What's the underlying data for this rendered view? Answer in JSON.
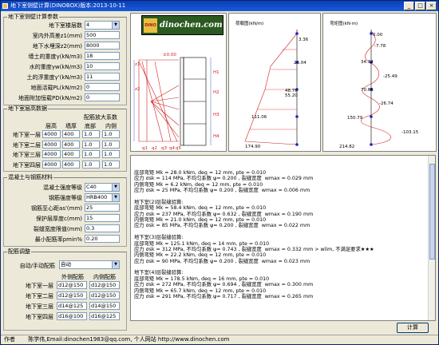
{
  "window": {
    "title": "地下室侧壁计算(DINOBOX)版本:2013-10-11",
    "btn_min": "_",
    "btn_max": "□",
    "btn_close": "×"
  },
  "basic": {
    "legend": "地下室侧壁计算参数",
    "rows": [
      {
        "label": "地下室楼层数",
        "value": "4",
        "type": "select"
      },
      {
        "label": "室内外高差z1(mm)",
        "value": "500"
      },
      {
        "label": "地下水埋深z2(mm)",
        "value": "8000"
      },
      {
        "label": "墙土的重度γ(kN/m3)",
        "value": "18"
      },
      {
        "label": "水的重度γw(kN/m3)",
        "value": "10"
      },
      {
        "label": "土的浮重度γ'(kN/m3)",
        "value": "11"
      },
      {
        "label": "地面活载PL(kN/m2)",
        "value": "0"
      },
      {
        "label": "地面附加恒载PD(kN/m2)",
        "value": "0"
      }
    ]
  },
  "floors": {
    "legend": "地下室层高数据",
    "col_height": "层高",
    "col_wall": "墙厚",
    "col_amp": "配筋放大系数",
    "col_out": "底部",
    "col_in": "内侧",
    "rows": [
      {
        "label": "地下室一层",
        "height": "4000",
        "wall": "400",
        "out": "1.0",
        "in": "1.0"
      },
      {
        "label": "地下室二层",
        "height": "4000",
        "wall": "400",
        "out": "1.0",
        "in": "1.0"
      },
      {
        "label": "地下室三层",
        "height": "4000",
        "wall": "400",
        "out": "1.0",
        "in": "1.0"
      },
      {
        "label": "地下室四层",
        "height": "4000",
        "wall": "400",
        "out": "1.0",
        "in": "1.0"
      }
    ]
  },
  "material": {
    "legend": "混凝土与钢筋材料",
    "rows": [
      {
        "label": "混凝土强度等级",
        "value": "C40",
        "type": "select"
      },
      {
        "label": "钢筋强度等级",
        "value": "HRB400",
        "type": "select"
      },
      {
        "label": "钢筋至心距as'(mm)",
        "value": "25"
      },
      {
        "label": "保护层厚度c(mm)",
        "value": "15"
      },
      {
        "label": "裂缝宽度限值(mm)",
        "value": "0.3"
      },
      {
        "label": "最小配筋率pmin%",
        "value": "0.20"
      }
    ]
  },
  "rebar": {
    "legend": "配筋调整",
    "mode_label": "自动/手动配筋",
    "mode_value": "自动",
    "col_out": "外侧配筋",
    "col_in": "内侧配筋",
    "rows": [
      {
        "label": "地下室一层",
        "out": "d12@150",
        "in": "d12@150"
      },
      {
        "label": "地下室二层",
        "out": "d12@150",
        "in": "d12@150"
      },
      {
        "label": "地下室三层",
        "out": "d14@125",
        "in": "d14@150"
      },
      {
        "label": "地下室四层",
        "out": "d16@100",
        "in": "d16@125"
      }
    ]
  },
  "logo": {
    "badge": "DINO",
    "text": "dinochen.com"
  },
  "diagram": {
    "labels": [
      "±0.00",
      "z1",
      "z2",
      "H1",
      "H2",
      "H3",
      "H4",
      "q1",
      "q2",
      "q3",
      "q4",
      "q5"
    ]
  },
  "load_chart": {
    "title": "荷载图(kN/m)",
    "values": [
      "3.36",
      "26.04",
      "48.76",
      "55.20",
      "111.06",
      "174.90"
    ]
  },
  "moment_chart": {
    "title": "弯矩图(kN·m)",
    "values": [
      "0.00",
      "-7.78",
      "34.34",
      "-25.49",
      "70.68",
      "-26.74",
      "150.79",
      "-103.15",
      "214.82"
    ]
  },
  "output": {
    "lines": [
      "底部弯矩 Mk = 28.0 kNm, deq = 12 mm, pte = 0.010",
      "应力 σsk = 114 MPa, 不均匀系数 ψ= 0.200 , 裂缝宽度  wmax = 0.029 mm",
      "内侧弯矩 Mk = 6.2 kNm, deq = 12 mm, pte = 0.010",
      "应力 σsk = 25 MPa, 不均匀系数 ψ= 0.200 , 裂缝宽度  wmax = 0.006 mm",
      "",
      "地下室(2)层裂缝验算:",
      "底部弯矩 Mk = 58.4 kNm, deq = 12 mm, pte = 0.010",
      "应力 σsk = 237 MPa, 不均匀系数 ψ= 0.632 , 裂缝宽度  wmax = 0.190 mm",
      "内侧弯矩 Mk = 21.0 kNm, deq = 12 mm, pte = 0.010",
      "应力 σsk = 85 MPa, 不均匀系数 ψ= 0.200 , 裂缝宽度  wmax = 0.022 mm",
      "",
      "地下室(3)层裂缝验算:",
      "底部弯矩 Mk = 125.1 kNm, deq = 14 mm, pte = 0.010",
      "应力 σsk = 312 MPa, 不均匀系数 ψ= 0.743 , 裂缝宽度  wmax = 0.332 mm > wlim, 不满足要求★★★",
      "内侧弯矩 Mk = 22.2 kNm, deq = 12 mm, pte = 0.010",
      "应力 σsk = 90 MPa, 不均匀系数 ψ= 0.200 , 裂缝宽度  wmax = 0.023 mm",
      "",
      "地下室(4)层裂缝验算:",
      "底部弯矩 Mk = 178.5 kNm, deq = 16 mm, pte = 0.010",
      "应力 σsk = 272 MPa, 不均匀系数 ψ= 0.694 , 裂缝宽度  wmax = 0.300 mm",
      "内侧弯矩 Mk = 65.7 kNm, deq = 12 mm, pte = 0.010",
      "应力 σsk = 291 MPa, 不均匀系数 ψ= 0.717 , 裂缝宽度  wmax = 0.265 mm"
    ]
  },
  "calc_button": "计算",
  "status": {
    "author_label": "作者",
    "text": "陈学伟,Email:dinochen1983@qq.com, 个人网站 http://www.dinochen.com"
  }
}
